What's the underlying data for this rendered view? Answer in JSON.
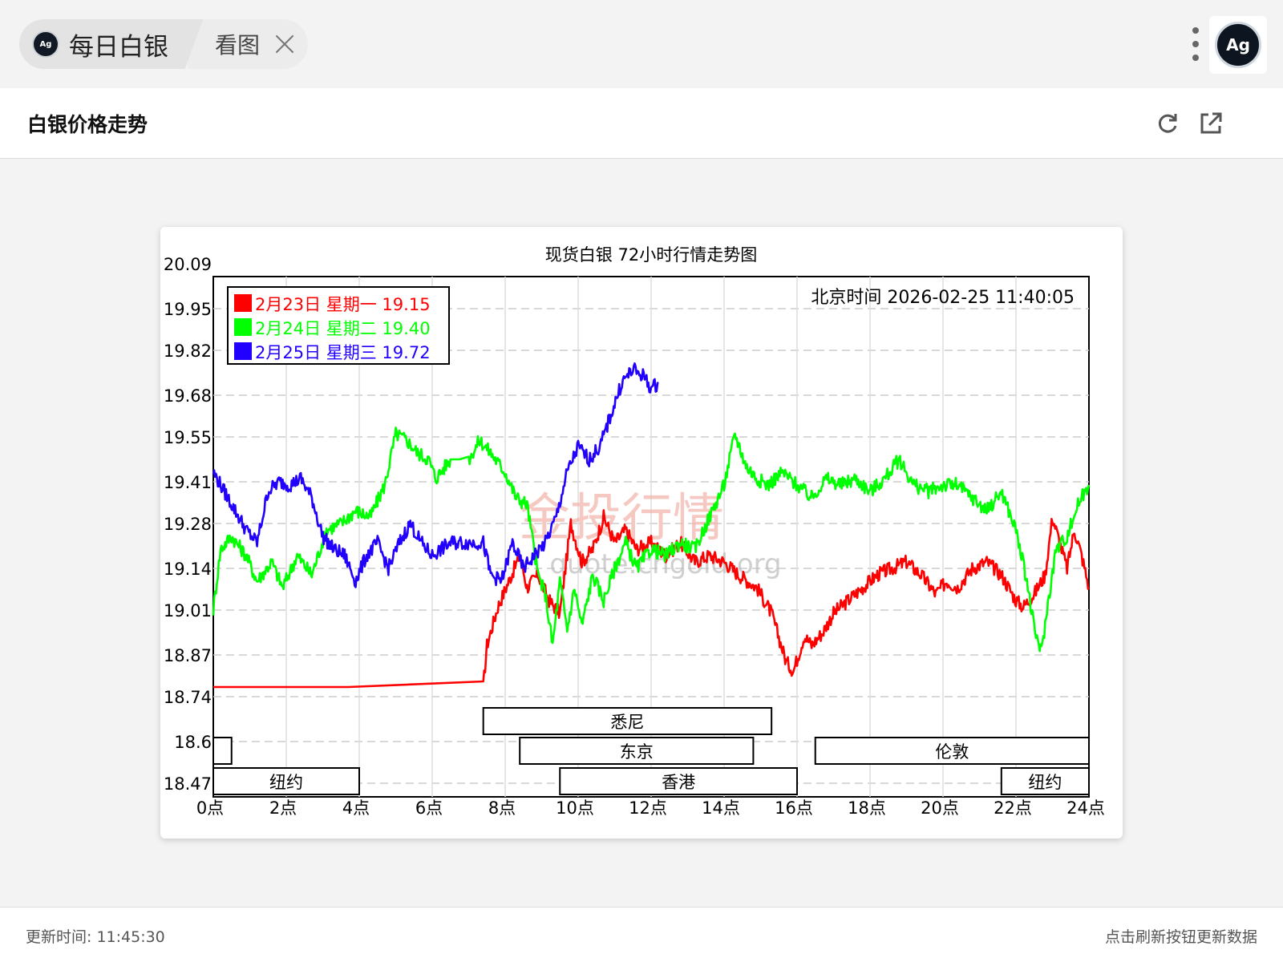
{
  "tab": {
    "logo_text": "Ag",
    "title": "每日白银",
    "second_label": "看图"
  },
  "avatar_text": "Ag",
  "header": {
    "title": "白银价格走势"
  },
  "footer": {
    "update_label": "更新时间: 11:45:30",
    "hint": "点击刷新按钮更新数据"
  },
  "watermark": {
    "main": "金投行情",
    "sub": "quote.cngold.org"
  },
  "colors": {
    "red": "#ff0000",
    "green": "#00ff00",
    "blue": "#2200ff"
  },
  "chart_data": {
    "type": "line",
    "title": "现货白银 72小时行情走势图",
    "timestamp_label": "北京时间 2026-02-25 11:40:05",
    "xlabel": "",
    "ylabel": "",
    "xlim": [
      0,
      24
    ],
    "ylim": [
      18.47,
      20.09
    ],
    "x_ticks": [
      0,
      2,
      4,
      6,
      8,
      10,
      12,
      14,
      16,
      18,
      20,
      22,
      24
    ],
    "x_tick_labels": [
      "0点",
      "2点",
      "4点",
      "6点",
      "8点",
      "10点",
      "12点",
      "14点",
      "16点",
      "18点",
      "20点",
      "22点",
      "24点"
    ],
    "y_ticks": [
      20.09,
      19.95,
      19.82,
      19.68,
      19.55,
      19.41,
      19.28,
      19.14,
      19.01,
      18.87,
      18.74,
      18.6,
      18.47
    ],
    "y_tick_labels": [
      "20.09",
      "19.95",
      "19.82",
      "19.68",
      "19.55",
      "19.41",
      "19.28",
      "19.14",
      "19.01",
      "18.87",
      "18.74",
      "18.6",
      "18.47"
    ],
    "grid": true,
    "legend_position": "top-left",
    "series": [
      {
        "name": "2月23日 星期一 19.15",
        "color": "#ff0000",
        "x": [
          0,
          7.4,
          7.5,
          7.8,
          8.1,
          8.4,
          8.6,
          8.9,
          9.2,
          9.5,
          9.8,
          10.1,
          10.4,
          10.7,
          11.0,
          11.3,
          11.6,
          12.0,
          12.4,
          12.8,
          13.2,
          13.6,
          14.0,
          14.4,
          14.9,
          15.3,
          15.7,
          15.9,
          16.2,
          16.4,
          16.7,
          17.0,
          17.4,
          17.8,
          18.2,
          18.6,
          19.0,
          19.4,
          19.8,
          20.1,
          20.4,
          20.8,
          21.2,
          21.6,
          22.0,
          22.2,
          22.5,
          22.8,
          23.0,
          23.2,
          23.4,
          23.6,
          23.8,
          24.0
        ],
        "y": [
          18.77,
          18.77,
          18.9,
          19.02,
          19.1,
          19.18,
          19.08,
          19.12,
          19.04,
          19.0,
          19.28,
          19.16,
          19.2,
          19.3,
          19.22,
          19.26,
          19.2,
          19.22,
          19.18,
          19.22,
          19.16,
          19.18,
          19.16,
          19.12,
          19.08,
          19.0,
          18.85,
          18.82,
          18.93,
          18.9,
          18.94,
          19.0,
          19.04,
          19.08,
          19.12,
          19.14,
          19.16,
          19.12,
          19.06,
          19.1,
          19.08,
          19.14,
          19.16,
          19.12,
          19.04,
          19.02,
          19.06,
          19.12,
          19.3,
          19.22,
          19.14,
          19.26,
          19.18,
          19.08
        ]
      },
      {
        "name": "2月24日 星期二 19.40",
        "color": "#00ff00",
        "x": [
          0,
          0.2,
          0.5,
          0.9,
          1.2,
          1.6,
          1.9,
          2.3,
          2.7,
          3.1,
          3.5,
          3.9,
          4.3,
          4.7,
          5.0,
          5.3,
          5.6,
          5.9,
          6.1,
          6.5,
          7.0,
          7.3,
          7.6,
          8.0,
          8.3,
          8.6,
          8.9,
          9.1,
          9.3,
          9.5,
          9.7,
          9.9,
          10.1,
          10.4,
          10.7,
          11.0,
          11.3,
          11.6,
          12.0,
          12.4,
          12.8,
          13.2,
          13.6,
          14.0,
          14.3,
          14.6,
          14.9,
          15.2,
          15.6,
          16.0,
          16.4,
          16.8,
          17.2,
          17.6,
          18.0,
          18.4,
          18.8,
          19.2,
          19.6,
          20.0,
          20.4,
          20.8,
          21.2,
          21.6,
          22.0,
          22.3,
          22.5,
          22.7,
          22.9,
          23.1,
          23.4,
          23.7,
          24.0
        ],
        "y": [
          19.01,
          19.2,
          19.24,
          19.18,
          19.1,
          19.16,
          19.08,
          19.18,
          19.12,
          19.26,
          19.28,
          19.32,
          19.3,
          19.4,
          19.56,
          19.54,
          19.5,
          19.48,
          19.42,
          19.48,
          19.48,
          19.54,
          19.5,
          19.44,
          19.36,
          19.34,
          19.12,
          19.06,
          18.9,
          19.1,
          18.95,
          19.08,
          18.96,
          19.12,
          19.04,
          19.14,
          19.22,
          19.14,
          19.2,
          19.18,
          19.22,
          19.2,
          19.3,
          19.4,
          19.56,
          19.46,
          19.42,
          19.4,
          19.44,
          19.4,
          19.36,
          19.42,
          19.4,
          19.42,
          19.38,
          19.42,
          19.48,
          19.4,
          19.38,
          19.4,
          19.4,
          19.36,
          19.32,
          19.38,
          19.26,
          19.1,
          18.95,
          18.88,
          19.05,
          19.2,
          19.24,
          19.34,
          19.4
        ]
      },
      {
        "name": "2月25日 星期三 19.72",
        "color": "#2200ff",
        "x": [
          0,
          0.2,
          0.4,
          0.6,
          0.9,
          1.2,
          1.5,
          1.8,
          2.1,
          2.4,
          2.7,
          3.0,
          3.3,
          3.6,
          3.9,
          4.2,
          4.5,
          4.8,
          5.1,
          5.4,
          5.7,
          6.0,
          6.5,
          7.0,
          7.4,
          7.6,
          7.9,
          8.2,
          8.5,
          8.8,
          9.1,
          9.4,
          9.7,
          10.0,
          10.3,
          10.6,
          10.9,
          11.2,
          11.5,
          11.8,
          12.0,
          12.2
        ],
        "y": [
          19.44,
          19.4,
          19.36,
          19.32,
          19.26,
          19.22,
          19.38,
          19.41,
          19.4,
          19.42,
          19.36,
          19.24,
          19.2,
          19.18,
          19.1,
          19.18,
          19.22,
          19.14,
          19.22,
          19.28,
          19.22,
          19.18,
          19.22,
          19.22,
          19.22,
          19.12,
          19.1,
          19.22,
          19.14,
          19.18,
          19.22,
          19.3,
          19.44,
          19.52,
          19.48,
          19.52,
          19.62,
          19.72,
          19.76,
          19.74,
          19.7,
          19.72
        ]
      }
    ],
    "market_sessions": [
      {
        "name": "悉尼",
        "start": 7.4,
        "end": 15.3
      },
      {
        "name": "东京",
        "start": 8.4,
        "end": 14.8
      },
      {
        "name": "伦敦",
        "start": 16.5,
        "end": 24.0
      },
      {
        "name": "",
        "start": 0,
        "end": 0.5
      },
      {
        "name": "纽约",
        "start": 0,
        "end": 4.0
      },
      {
        "name": "香港",
        "start": 9.5,
        "end": 16.0
      },
      {
        "name": "纽约",
        "start": 21.6,
        "end": 24.0
      }
    ]
  }
}
